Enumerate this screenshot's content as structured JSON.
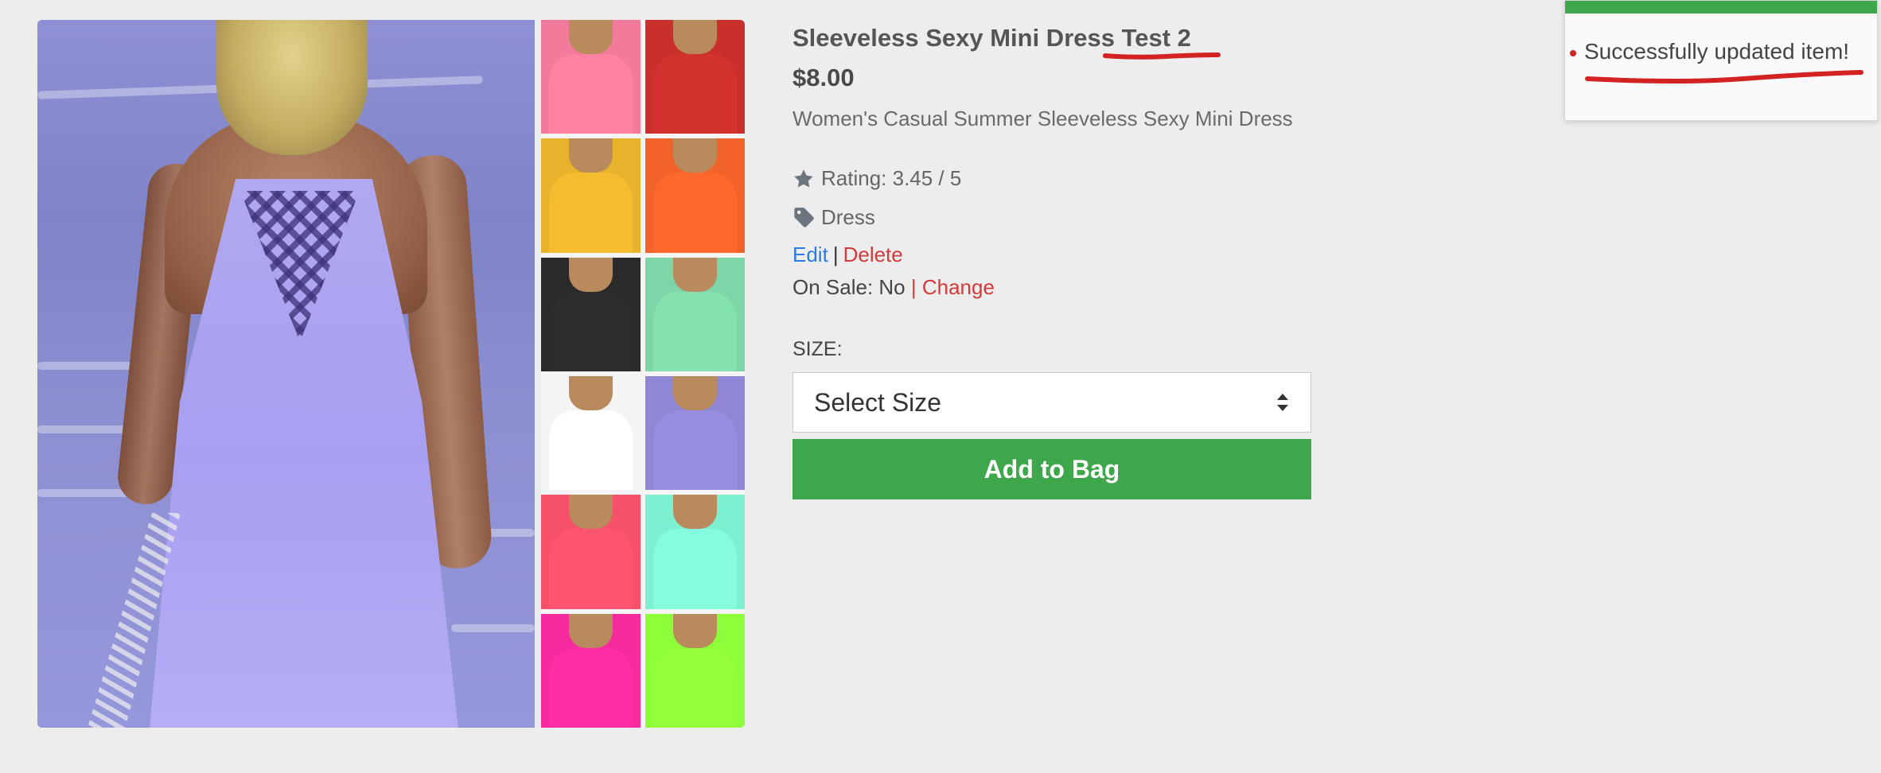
{
  "product": {
    "title": "Sleeveless Sexy Mini Dress Test 2",
    "price": "$8.00",
    "subtitle": "Women's Casual Summer Sleeveless Sexy Mini Dress",
    "rating_text": "Rating: 3.45 / 5",
    "category": "Dress",
    "edit_label": "Edit",
    "separator": "|",
    "delete_label": "Delete",
    "on_sale_text": "On Sale: No",
    "change_label": "| Change",
    "size_label": "SIZE:",
    "size_select_value": "Select Size",
    "add_to_bag_label": "Add to Bag"
  },
  "notification": {
    "message": "Successfully updated item!"
  },
  "icons": {
    "rating": "star-icon",
    "category": "tag-icon",
    "select": "sort-arrows-icon"
  },
  "colors": {
    "accent_green": "#3ea64b",
    "link_blue": "#2a7ae2",
    "link_red": "#d33a3a",
    "annotation_red": "#d32222"
  },
  "thumbnails": [
    {
      "color": "#f27a9a"
    },
    {
      "color": "#c9302c"
    },
    {
      "color": "#e8b32c"
    },
    {
      "color": "#f2632a"
    },
    {
      "color": "#2a2a2a"
    },
    {
      "color": "#7ed6a8"
    },
    {
      "color": "#f4f4f4"
    },
    {
      "color": "#8f86d6"
    },
    {
      "color": "#f7506a"
    },
    {
      "color": "#7ef0d2"
    },
    {
      "color": "#f72a9e"
    },
    {
      "color": "#8cff3a"
    }
  ]
}
